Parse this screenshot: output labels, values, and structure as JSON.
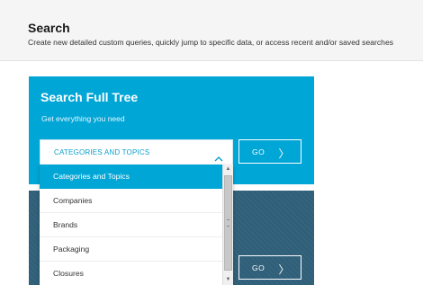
{
  "header": {
    "title": "Search",
    "subtitle": "Create new detailed custom queries, quickly jump to specific data, or access recent and/or saved searches"
  },
  "full_tree_panel": {
    "title": "Search Full Tree",
    "subtitle": "Get everything you need",
    "select_value": "CATEGORIES AND TOPICS",
    "go_label": "GO",
    "go_arrow": "〉"
  },
  "dropdown": {
    "options": [
      {
        "label": "Categories and Topics",
        "selected": true
      },
      {
        "label": "Companies",
        "selected": false
      },
      {
        "label": "Brands",
        "selected": false
      },
      {
        "label": "Packaging",
        "selected": false
      },
      {
        "label": "Closures",
        "selected": false
      }
    ]
  },
  "second_panel": {
    "go_label": "GO",
    "go_arrow": "〉"
  },
  "colors": {
    "accent": "#00a6d6",
    "panel_dark": "#2f5f79"
  },
  "icons": {
    "chevron": "chevron-up-icon",
    "go_arrow": "chevron-right-icon"
  }
}
